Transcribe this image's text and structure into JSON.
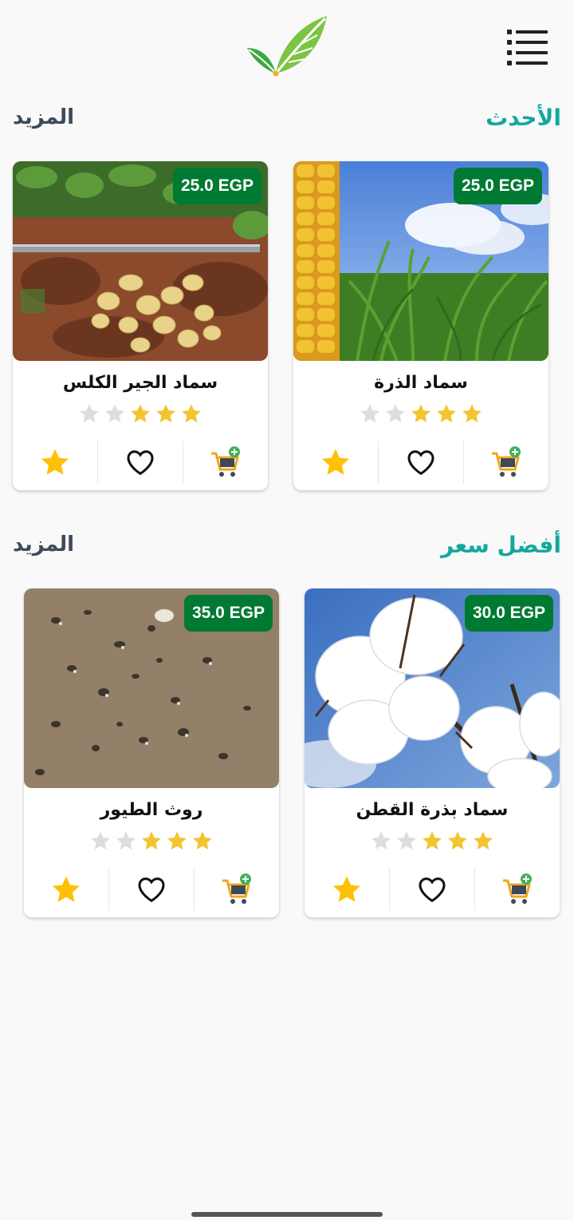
{
  "app": {
    "logo_icon": "leaf-logo-icon",
    "menu_icon": "menu-list-icon"
  },
  "colors": {
    "accent": "#13a89e",
    "price_badge": "#007a33",
    "star_filled": "#f4c430",
    "star_empty": "#dddddd"
  },
  "sections": [
    {
      "title": "الأحدث",
      "more": "المزيد",
      "products": [
        {
          "name": "سماد الذرة",
          "price": "25.0 EGP",
          "rating": 3,
          "max_rating": 5,
          "image": "corn-field-image"
        },
        {
          "name": "سماد الجير الكلس",
          "price": "25.0 EGP",
          "rating": 3,
          "max_rating": 5,
          "image": "potato-soil-image"
        }
      ]
    },
    {
      "title": "أفضل سعر",
      "more": "المزيد",
      "products": [
        {
          "name": "سماد بذرة القطن",
          "price": "30.0 EGP",
          "rating": 3,
          "max_rating": 5,
          "image": "cotton-boll-image"
        },
        {
          "name": "روث الطيور",
          "price": "35.0 EGP",
          "rating": 3,
          "max_rating": 5,
          "image": "poultry-manure-image"
        }
      ]
    }
  ]
}
